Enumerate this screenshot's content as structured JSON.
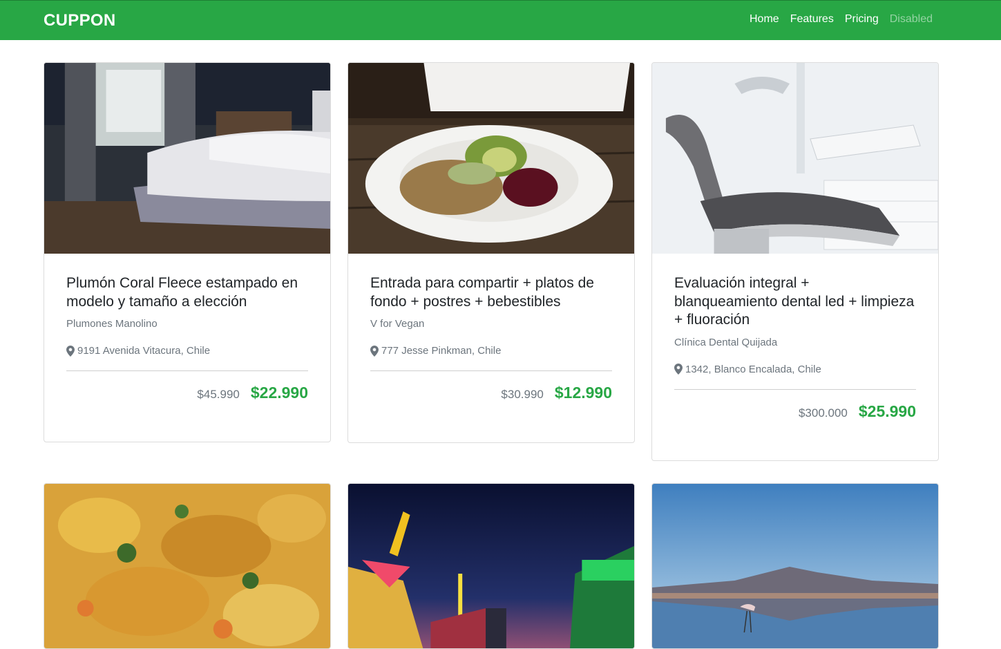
{
  "navbar": {
    "brand": "CUPPON",
    "links": [
      {
        "label": "Home"
      },
      {
        "label": "Features"
      },
      {
        "label": "Pricing"
      },
      {
        "label": "Disabled"
      }
    ]
  },
  "cards": [
    {
      "title": "Plumón Coral Fleece estampado en modelo y tamaño a elección",
      "merchant": "Plumones Manolino",
      "location": "9191 Avenida Vitacura, Chile",
      "old_price": "$45.990",
      "new_price": "$22.990",
      "image": "bedroom-photo"
    },
    {
      "title": "Entrada para compartir + platos de fondo + postres + bebestibles",
      "merchant": "V for Vegan",
      "location": "777 Jesse Pinkman, Chile",
      "old_price": "$30.990",
      "new_price": "$12.990",
      "image": "vegan-dish-photo"
    },
    {
      "title": "Evaluación integral + blanqueamiento dental led + limpieza + fluoración",
      "merchant": "Clínica Dental Quijada",
      "location": "1342, Blanco Encalada, Chile",
      "old_price": "$300.000",
      "new_price": "$25.990",
      "image": "dental-chair-photo"
    },
    {
      "image": "stew-photo"
    },
    {
      "image": "fairground-night-photo"
    },
    {
      "image": "flamingo-lake-photo"
    }
  ],
  "colors": {
    "brand_green": "#28a745",
    "muted_text": "#6c757d"
  },
  "icons": {
    "location": "map-marker-icon"
  }
}
